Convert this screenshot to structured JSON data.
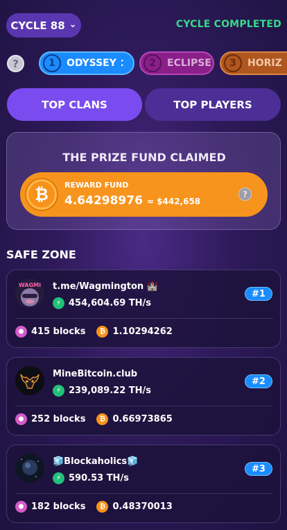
{
  "header": {
    "cycle_label": "CYCLE 88",
    "cycle_status": "CYCLE COMPLETED"
  },
  "seasons": [
    {
      "num": "1",
      "label": "ODYSSEY"
    },
    {
      "num": "2",
      "label": "ECLIPSE"
    },
    {
      "num": "3",
      "label": "HORIZ"
    }
  ],
  "toggle": {
    "clans_label": "TOP CLANS",
    "players_label": "TOP PLAYERS"
  },
  "prize": {
    "title": "THE PRIZE FUND CLAIMED",
    "reward_label": "REWARD FUND",
    "btc_value": "4.64298976",
    "usd_value": "≈ $442,658"
  },
  "section_title": "SAFE ZONE",
  "clans": [
    {
      "name": "t.me/Wagmington 🏰",
      "hashrate": "454,604.69 TH/s",
      "rank": "#1",
      "blocks": "415 blocks",
      "btc": "1.10294262",
      "avatar_text": "WAGMI"
    },
    {
      "name": "MineBitcoin.club",
      "hashrate": "239,089.22 TH/s",
      "rank": "#2",
      "blocks": "252 blocks",
      "btc": "0.66973865",
      "avatar_text": ""
    },
    {
      "name": "🧊Blockaholics🧊",
      "hashrate": "590.53 TH/s",
      "rank": "#3",
      "blocks": "182 blocks",
      "btc": "0.48370013",
      "avatar_text": ""
    }
  ],
  "colors": {
    "accent": "#7a4cf0",
    "status_green": "#39d98a",
    "bitcoin_orange": "#f7941d",
    "rank_blue": "#1a8cff"
  }
}
